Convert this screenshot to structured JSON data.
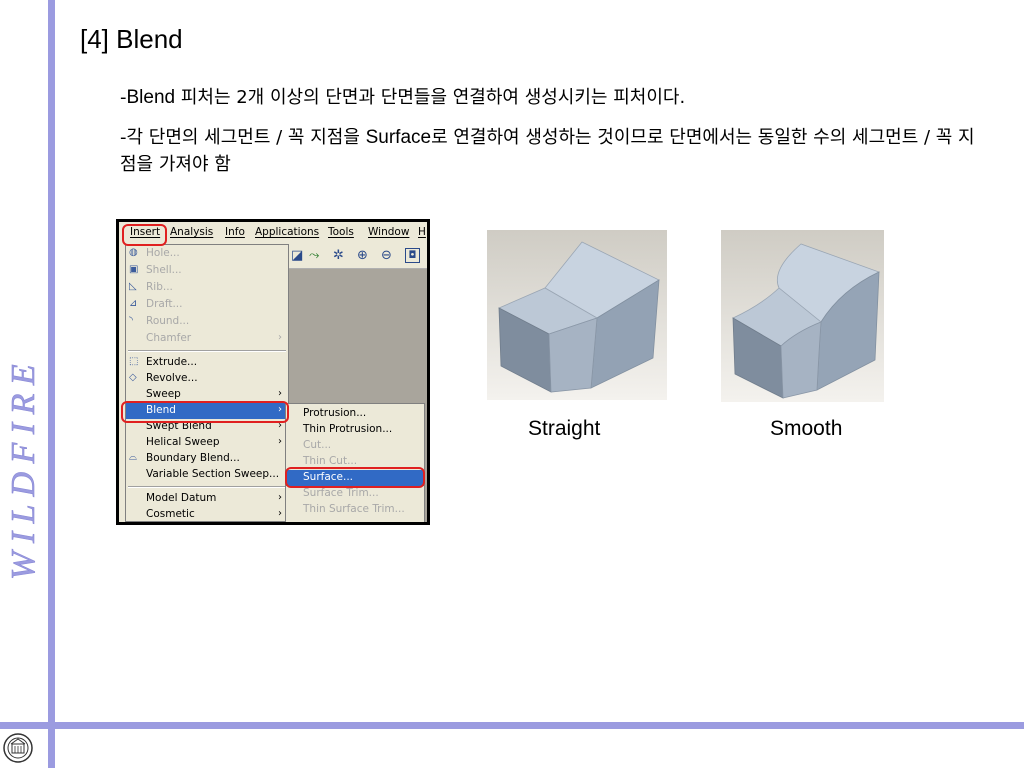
{
  "side_brand": "W I L D   F I R E",
  "title": "[4] Blend",
  "paragraph1": {
    "prefix": "-",
    "latin": "Blend",
    "rest": " 피처는 2개 이상의 단면과 단면들을 연결하여 생성시키는 피처이다."
  },
  "paragraph2": {
    "prefix": "-각 단면의 세그먼트 / 꼭 지점을 ",
    "latin": "Surface",
    "rest": "로 연결하여 생성하는 것이므로 단면에서는 동일한 수의 세그먼트 / 꼭 지점을 가져야 함"
  },
  "menubar": [
    "Insert",
    "Analysis",
    "Info",
    "Applications",
    "Tools",
    "Window",
    "H"
  ],
  "menu_items": [
    {
      "label": "Hole...",
      "icon": "hole-icon",
      "disabled": true
    },
    {
      "label": "Shell...",
      "icon": "shell-icon",
      "disabled": true
    },
    {
      "label": "Rib...",
      "icon": "rib-icon",
      "disabled": true
    },
    {
      "label": "Draft...",
      "icon": "draft-icon",
      "disabled": true
    },
    {
      "label": "Round...",
      "icon": "round-icon",
      "disabled": true
    },
    {
      "label": "Chamfer",
      "icon": "",
      "disabled": true,
      "submenu": true
    },
    {
      "label": "Extrude...",
      "icon": "extrude-icon",
      "disabled": false
    },
    {
      "label": "Revolve...",
      "icon": "revolve-icon",
      "disabled": false
    },
    {
      "label": "Sweep",
      "icon": "",
      "disabled": false,
      "submenu": true
    },
    {
      "label": "Blend",
      "icon": "",
      "disabled": false,
      "submenu": true,
      "highlight": true
    },
    {
      "label": "Swept Blend",
      "icon": "",
      "disabled": false,
      "submenu": true
    },
    {
      "label": "Helical Sweep",
      "icon": "",
      "disabled": false,
      "submenu": true
    },
    {
      "label": "Boundary Blend...",
      "icon": "boundary-blend-icon",
      "disabled": false
    },
    {
      "label": "Variable Section Sweep...",
      "icon": "",
      "disabled": false
    },
    {
      "label": "Model Datum",
      "icon": "",
      "disabled": false,
      "submenu": true
    },
    {
      "label": "Cosmetic",
      "icon": "",
      "disabled": false,
      "submenu": true
    }
  ],
  "submenu_items": [
    {
      "label": "Protrusion...",
      "disabled": false
    },
    {
      "label": "Thin Protrusion...",
      "disabled": false
    },
    {
      "label": "Cut...",
      "disabled": true
    },
    {
      "label": "Thin Cut...",
      "disabled": true
    },
    {
      "label": "Surface...",
      "disabled": false,
      "highlight": true
    },
    {
      "label": "Surface Trim...",
      "disabled": true
    },
    {
      "label": "Thin Surface Trim...",
      "disabled": true
    }
  ],
  "arrow_glyph": "›",
  "captions": {
    "straight": "Straight",
    "smooth": "Smooth"
  },
  "colors": {
    "accent_bar": "#9b9be0",
    "highlight": "#316ac5",
    "callout": "#e02020",
    "model_face": "#b9c6d6"
  }
}
